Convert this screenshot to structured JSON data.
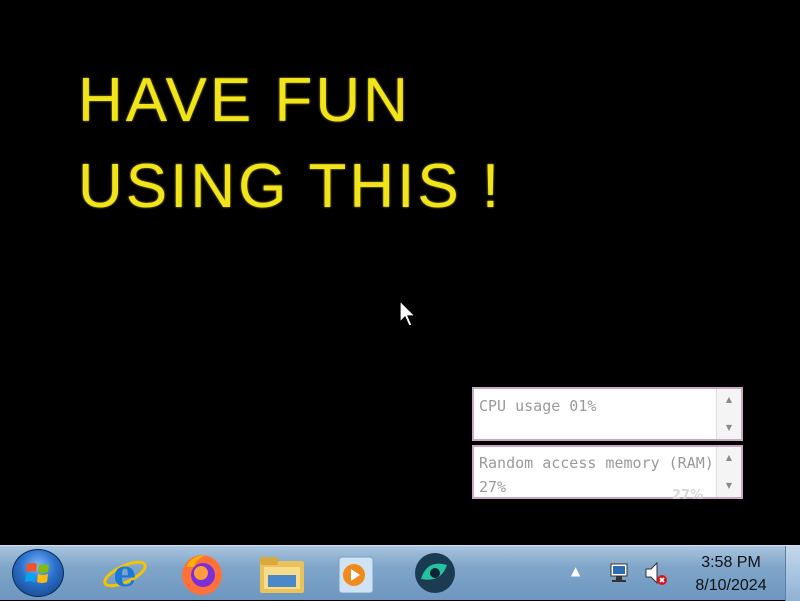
{
  "wallpaper": {
    "line1": "HAVE FUN",
    "line2": "USING THIS !"
  },
  "gadgets": {
    "cpu": {
      "text": "CPU usage 01%"
    },
    "ram": {
      "text": "Random access memory (RAM) 27%",
      "overlay": "27%"
    }
  },
  "taskbar": {
    "start_icon": "windows-start-orb",
    "pinned": [
      {
        "name": "internet-explorer-icon"
      },
      {
        "name": "firefox-icon"
      },
      {
        "name": "file-explorer-icon"
      },
      {
        "name": "media-player-icon"
      },
      {
        "name": "app-icon"
      }
    ],
    "tray": {
      "time": "3:58 PM",
      "date": "8/10/2024"
    }
  },
  "colors": {
    "wallpaper_text": "#f2e41a",
    "desktop": "#000000",
    "taskbar": "#7fa5c9"
  }
}
